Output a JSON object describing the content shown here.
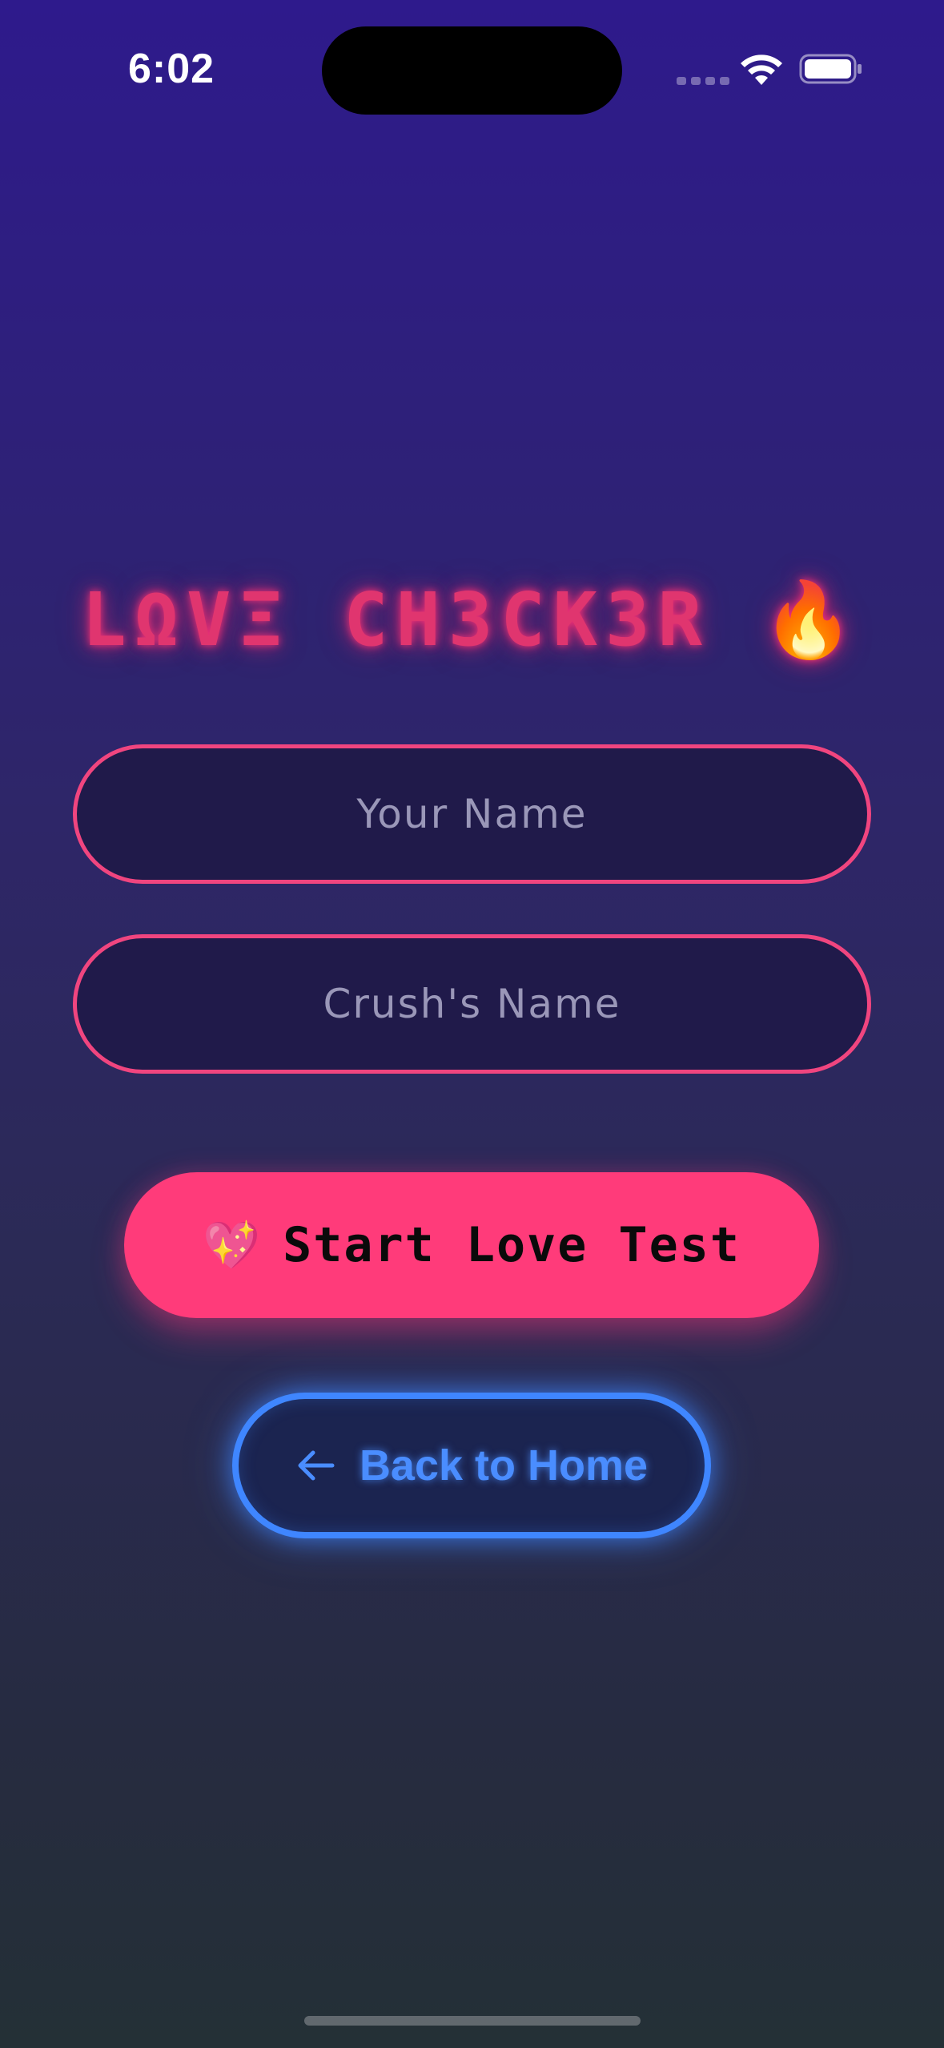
{
  "status_bar": {
    "time": "6:02",
    "icons": [
      "cellular-signal-icon",
      "wifi-icon",
      "battery-icon"
    ]
  },
  "title": {
    "text": "LΩVΞ CH3CK3R",
    "emoji": "🔥",
    "color": "#e0356f"
  },
  "form": {
    "your_name": {
      "placeholder": "Your Name",
      "value": ""
    },
    "crush_name": {
      "placeholder": "Crush's Name",
      "value": ""
    }
  },
  "start_button": {
    "icon": "sparkling-heart-icon",
    "emoji": "💖",
    "label": "Start Love Test",
    "color": "#ff3b7a"
  },
  "back_button": {
    "icon": "arrow-left-icon",
    "label": "Back to Home",
    "color": "#3f86ff"
  },
  "theme": {
    "background_top": "#2e1a8c",
    "background_bottom": "#243036",
    "input_border": "#f0457f",
    "input_fill": "#201a4a"
  }
}
